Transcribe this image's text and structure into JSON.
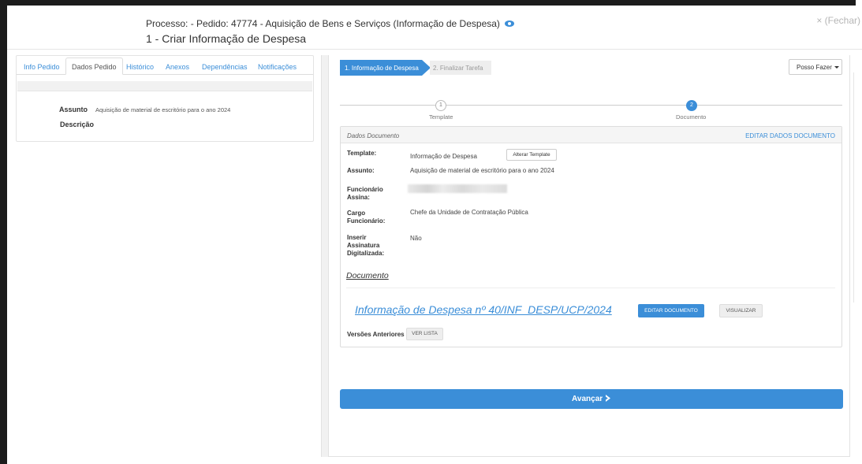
{
  "header": {
    "process_line": "Processo: - Pedido: 47774 - Aquisição de Bens e Serviços (Informação de Despesa)",
    "task_title": "1 - Criar Informação de Despesa",
    "close_label": "× (Fechar)"
  },
  "left_tabs": [
    {
      "label": "Info Pedido"
    },
    {
      "label": "Dados Pedido"
    },
    {
      "label": "Histórico"
    },
    {
      "label": "Anexos"
    },
    {
      "label": "Dependências"
    },
    {
      "label": "Notificações"
    }
  ],
  "active_left_tab": "Dados Pedido",
  "pedido": {
    "assunto_label": "Assunto",
    "assunto_value": "Aquisição de material de escritório para o ano 2024",
    "descricao_label": "Descrição"
  },
  "wizard": {
    "steps": [
      {
        "label": "1. Informação de Despesa",
        "active": true
      },
      {
        "label": "2. Finalizar Tarefa",
        "active": false
      }
    ],
    "actions_label": "Posso Fazer",
    "progress": [
      {
        "number": "1",
        "label": "Template"
      },
      {
        "number": "2",
        "label": "Documento"
      }
    ]
  },
  "dados_documento": {
    "title": "Dados Documento",
    "edit_label": "EDITAR DADOS DOCUMENTO",
    "fields": [
      {
        "label": "Template:",
        "value": "Informação de Despesa"
      },
      {
        "label": "Assunto:",
        "value": "Aquisição de material de escritório para o ano 2024"
      },
      {
        "label": "Funcionário Assina:",
        "value": ""
      },
      {
        "label": "Cargo Funcionário:",
        "value": "Chefe da Unidade de Contratação Pública"
      },
      {
        "label": "Inserir Assinatura Digitalizada:",
        "value": "Não"
      }
    ],
    "alter_template_label": "Alterar Template",
    "documento_section": "Documento",
    "document_link": "Informação de Despesa nº 40/INF_DESP/UCP/2024",
    "edit_document_label": "EDITAR DOCUMENTO",
    "view_label": "VISUALIZAR",
    "versions_label": "Versões Anteriores",
    "view_list_label": "VER LISTA"
  },
  "advance_label": "Avançar",
  "colors": {
    "accent": "#3b8ed8",
    "frame": "#1c1c1c"
  }
}
